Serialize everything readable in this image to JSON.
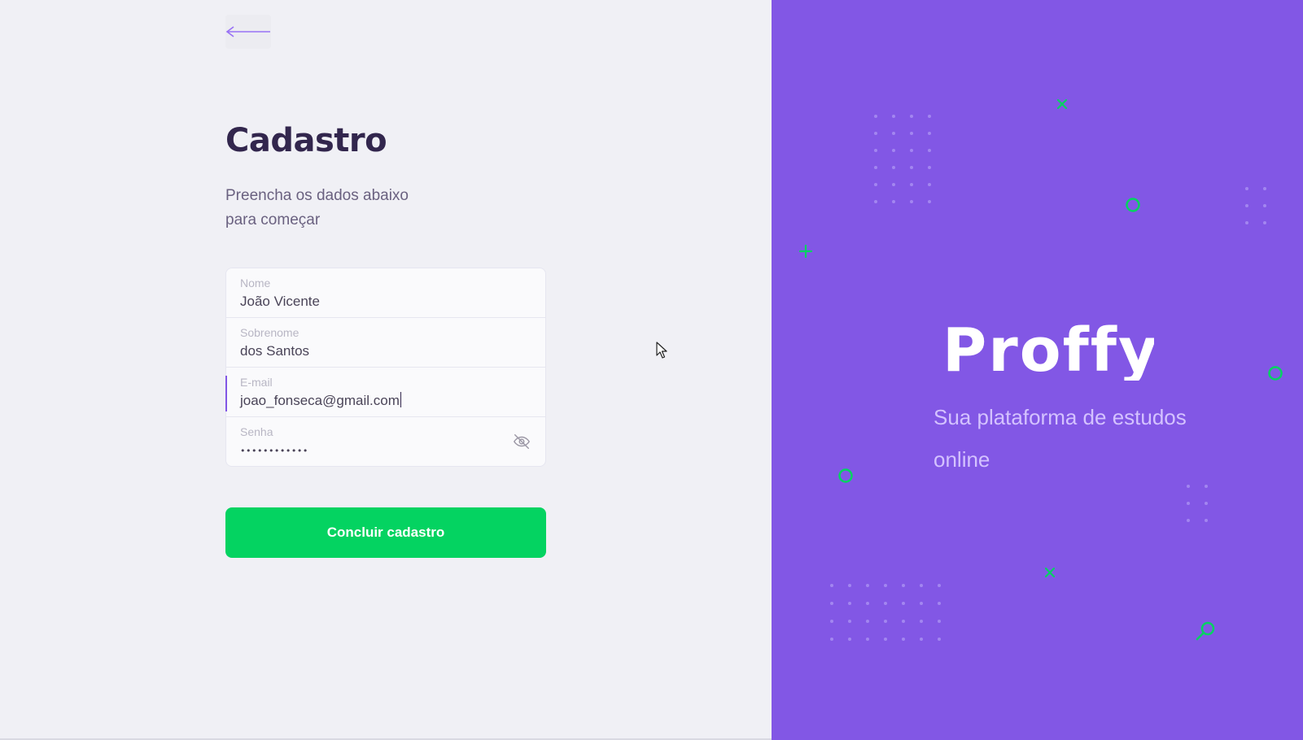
{
  "form": {
    "title": "Cadastro",
    "subtitle": "Preencha os dados abaixo para começar",
    "fields": {
      "first_name": {
        "label": "Nome",
        "value": "João Vicente"
      },
      "last_name": {
        "label": "Sobrenome",
        "value": "dos Santos"
      },
      "email": {
        "label": "E-mail",
        "value": "joao_fonseca@gmail.com"
      },
      "password": {
        "label": "Senha",
        "value": "••••••••••••"
      }
    },
    "submit_label": "Concluir cadastro"
  },
  "brand": {
    "name": "Proffy",
    "tagline": "Sua plataforma de estudos online"
  },
  "colors": {
    "primary": "#8257e5",
    "success": "#04d361",
    "title": "#32264d",
    "background": "#f0f0f5"
  },
  "icons": {
    "back": "arrow-left-icon",
    "password_toggle": "eye-off-icon",
    "pointer": "mouse-pointer-icon"
  }
}
